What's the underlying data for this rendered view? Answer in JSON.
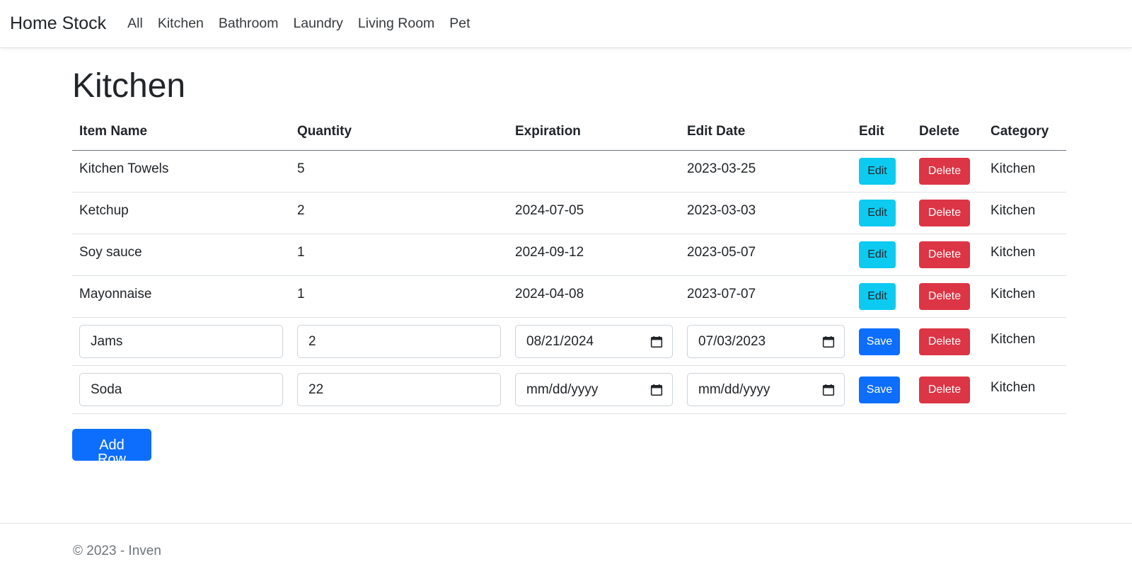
{
  "navbar": {
    "brand": "Home Stock",
    "links": [
      "All",
      "Kitchen",
      "Bathroom",
      "Laundry",
      "Living Room",
      "Pet"
    ]
  },
  "page": {
    "title": "Kitchen"
  },
  "table": {
    "headers": [
      "Item Name",
      "Quantity",
      "Expiration",
      "Edit Date",
      "Edit",
      "Delete",
      "Category"
    ],
    "rows": [
      {
        "name": "Kitchen Towels",
        "quantity": "5",
        "expiration": "",
        "edit_date": "2023-03-25",
        "edit_label": "Edit",
        "delete_label": "Delete",
        "category": "Kitchen"
      },
      {
        "name": "Ketchup",
        "quantity": "2",
        "expiration": "2024-07-05",
        "edit_date": "2023-03-03",
        "edit_label": "Edit",
        "delete_label": "Delete",
        "category": "Kitchen"
      },
      {
        "name": "Soy sauce",
        "quantity": "1",
        "expiration": "2024-09-12",
        "edit_date": "2023-05-07",
        "edit_label": "Edit",
        "delete_label": "Delete",
        "category": "Kitchen"
      },
      {
        "name": "Mayonnaise",
        "quantity": "1",
        "expiration": "2024-04-08",
        "edit_date": "2023-07-07",
        "edit_label": "Edit",
        "delete_label": "Delete",
        "category": "Kitchen"
      }
    ],
    "edit_rows": [
      {
        "name": "Jams",
        "quantity": "2",
        "expiration": "08/21/2024",
        "edit_date": "07/03/2023",
        "save_label": "Save",
        "delete_label": "Delete",
        "category": "Kitchen"
      },
      {
        "name": "Soda",
        "quantity": "22",
        "expiration": "mm/dd/yyyy",
        "edit_date": "mm/dd/yyyy",
        "save_label": "Save",
        "delete_label": "Delete",
        "category": "Kitchen"
      }
    ]
  },
  "actions": {
    "add_row_label": "Add Row"
  },
  "footer": {
    "text": "© 2023 - Inven"
  },
  "colors": {
    "edit": "#0dcaf0",
    "delete": "#dc3545",
    "primary": "#0d6efd"
  },
  "icons": {
    "date_picker": "calendar-icon"
  }
}
